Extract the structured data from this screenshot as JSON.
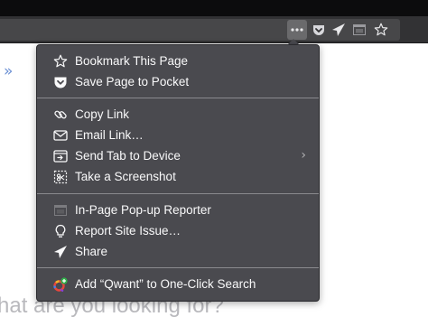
{
  "toolbar": {
    "icons": [
      "page-actions-icon",
      "pocket-icon",
      "send-tab-icon",
      "popup-reporter-icon",
      "bookmark-star-icon"
    ]
  },
  "page": {
    "nav_chevron": "»",
    "search_prompt": "hat are you looking for?"
  },
  "page_actions_menu": {
    "items": [
      {
        "label": "Bookmark This Page",
        "icon": "star-icon"
      },
      {
        "label": "Save Page to Pocket",
        "icon": "pocket-icon"
      },
      {
        "label": "Copy Link",
        "icon": "link-icon"
      },
      {
        "label": "Email Link…",
        "icon": "email-icon"
      },
      {
        "label": "Send Tab to Device",
        "icon": "send-tab-icon",
        "submenu": "›"
      },
      {
        "label": "Take a Screenshot",
        "icon": "screenshot-icon"
      },
      {
        "label": "In-Page Pop-up Reporter",
        "icon": "popup-reporter-icon"
      },
      {
        "label": "Report Site Issue…",
        "icon": "lightbulb-icon"
      },
      {
        "label": "Share",
        "icon": "share-icon"
      },
      {
        "label": "Add “Qwant” to One-Click Search",
        "icon": "add-search-engine-icon"
      }
    ]
  },
  "colors": {
    "menu_background": "#4a4a4f",
    "menu_text": "#f9f9fa",
    "toolbar": "#323234",
    "chevron_accent": "#6a8fd3"
  }
}
